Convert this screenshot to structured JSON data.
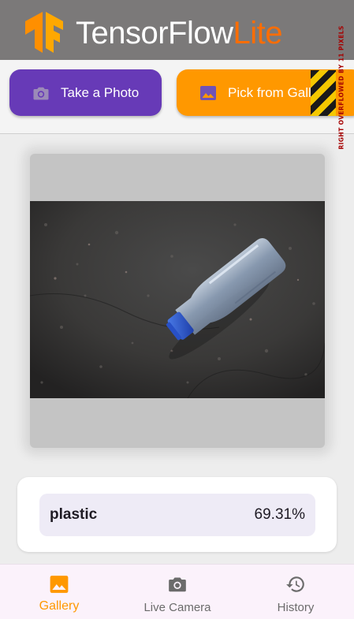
{
  "app_bar": {
    "title_part1": "TensorFlow",
    "title_part2": "Lite",
    "logo_icon": "tensorflow-logo",
    "bg_color": "#7b7979",
    "accent_color": "#ff6d00"
  },
  "actions": {
    "take_photo_label": "Take a Photo",
    "take_photo_icon": "camera-icon",
    "take_photo_color": "#673ab7",
    "pick_gallery_label": "Pick from Gallery",
    "pick_gallery_icon": "image-icon",
    "pick_gallery_color": "#ff9800"
  },
  "debug_overflow": {
    "text": "RIGHT OVERFLOWED BY 11 PIXELS"
  },
  "preview": {
    "image_icon": "plastic-bottle-photo"
  },
  "result": {
    "label": "plastic",
    "confidence": "69.31%"
  },
  "bottom_nav": {
    "active_index": 0,
    "items": [
      {
        "label": "Gallery",
        "icon": "image-icon"
      },
      {
        "label": "Live Camera",
        "icon": "camera-icon"
      },
      {
        "label": "History",
        "icon": "history-icon"
      }
    ]
  }
}
